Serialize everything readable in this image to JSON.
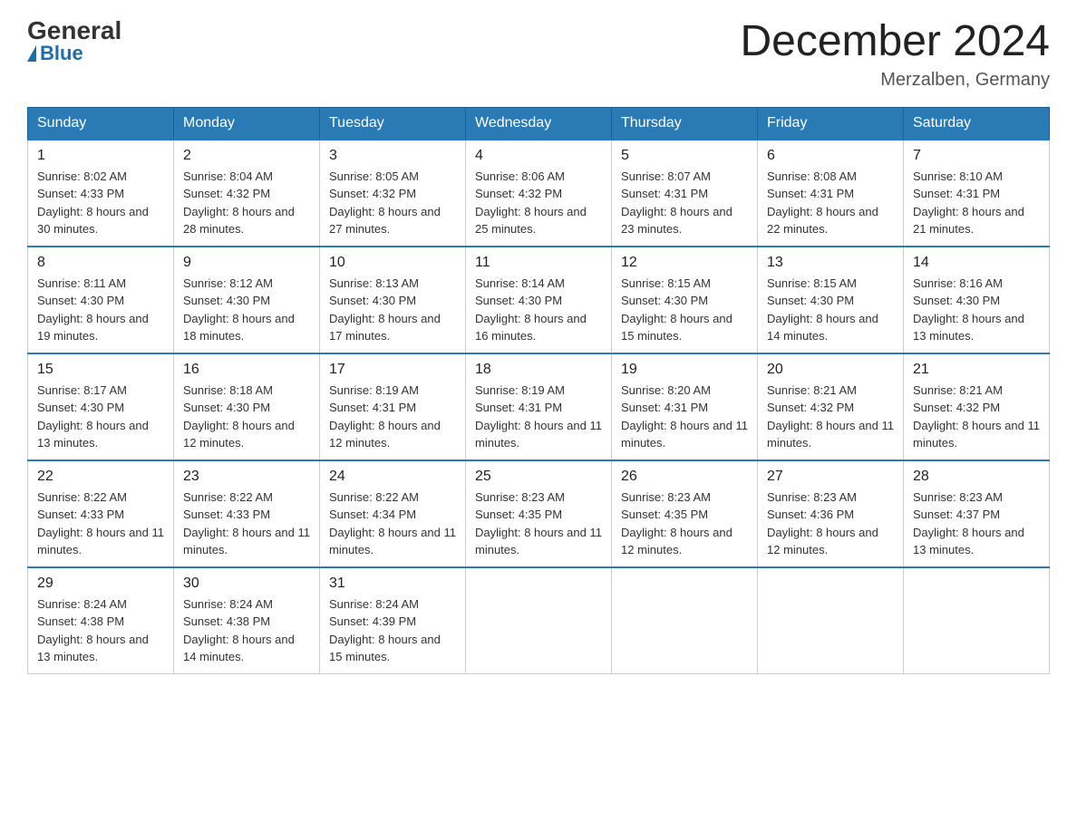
{
  "logo": {
    "general": "General",
    "blue": "Blue"
  },
  "title": "December 2024",
  "location": "Merzalben, Germany",
  "days_of_week": [
    "Sunday",
    "Monday",
    "Tuesday",
    "Wednesday",
    "Thursday",
    "Friday",
    "Saturday"
  ],
  "weeks": [
    [
      {
        "day": "1",
        "sunrise": "8:02 AM",
        "sunset": "4:33 PM",
        "daylight": "8 hours and 30 minutes."
      },
      {
        "day": "2",
        "sunrise": "8:04 AM",
        "sunset": "4:32 PM",
        "daylight": "8 hours and 28 minutes."
      },
      {
        "day": "3",
        "sunrise": "8:05 AM",
        "sunset": "4:32 PM",
        "daylight": "8 hours and 27 minutes."
      },
      {
        "day": "4",
        "sunrise": "8:06 AM",
        "sunset": "4:32 PM",
        "daylight": "8 hours and 25 minutes."
      },
      {
        "day": "5",
        "sunrise": "8:07 AM",
        "sunset": "4:31 PM",
        "daylight": "8 hours and 23 minutes."
      },
      {
        "day": "6",
        "sunrise": "8:08 AM",
        "sunset": "4:31 PM",
        "daylight": "8 hours and 22 minutes."
      },
      {
        "day": "7",
        "sunrise": "8:10 AM",
        "sunset": "4:31 PM",
        "daylight": "8 hours and 21 minutes."
      }
    ],
    [
      {
        "day": "8",
        "sunrise": "8:11 AM",
        "sunset": "4:30 PM",
        "daylight": "8 hours and 19 minutes."
      },
      {
        "day": "9",
        "sunrise": "8:12 AM",
        "sunset": "4:30 PM",
        "daylight": "8 hours and 18 minutes."
      },
      {
        "day": "10",
        "sunrise": "8:13 AM",
        "sunset": "4:30 PM",
        "daylight": "8 hours and 17 minutes."
      },
      {
        "day": "11",
        "sunrise": "8:14 AM",
        "sunset": "4:30 PM",
        "daylight": "8 hours and 16 minutes."
      },
      {
        "day": "12",
        "sunrise": "8:15 AM",
        "sunset": "4:30 PM",
        "daylight": "8 hours and 15 minutes."
      },
      {
        "day": "13",
        "sunrise": "8:15 AM",
        "sunset": "4:30 PM",
        "daylight": "8 hours and 14 minutes."
      },
      {
        "day": "14",
        "sunrise": "8:16 AM",
        "sunset": "4:30 PM",
        "daylight": "8 hours and 13 minutes."
      }
    ],
    [
      {
        "day": "15",
        "sunrise": "8:17 AM",
        "sunset": "4:30 PM",
        "daylight": "8 hours and 13 minutes."
      },
      {
        "day": "16",
        "sunrise": "8:18 AM",
        "sunset": "4:30 PM",
        "daylight": "8 hours and 12 minutes."
      },
      {
        "day": "17",
        "sunrise": "8:19 AM",
        "sunset": "4:31 PM",
        "daylight": "8 hours and 12 minutes."
      },
      {
        "day": "18",
        "sunrise": "8:19 AM",
        "sunset": "4:31 PM",
        "daylight": "8 hours and 11 minutes."
      },
      {
        "day": "19",
        "sunrise": "8:20 AM",
        "sunset": "4:31 PM",
        "daylight": "8 hours and 11 minutes."
      },
      {
        "day": "20",
        "sunrise": "8:21 AM",
        "sunset": "4:32 PM",
        "daylight": "8 hours and 11 minutes."
      },
      {
        "day": "21",
        "sunrise": "8:21 AM",
        "sunset": "4:32 PM",
        "daylight": "8 hours and 11 minutes."
      }
    ],
    [
      {
        "day": "22",
        "sunrise": "8:22 AM",
        "sunset": "4:33 PM",
        "daylight": "8 hours and 11 minutes."
      },
      {
        "day": "23",
        "sunrise": "8:22 AM",
        "sunset": "4:33 PM",
        "daylight": "8 hours and 11 minutes."
      },
      {
        "day": "24",
        "sunrise": "8:22 AM",
        "sunset": "4:34 PM",
        "daylight": "8 hours and 11 minutes."
      },
      {
        "day": "25",
        "sunrise": "8:23 AM",
        "sunset": "4:35 PM",
        "daylight": "8 hours and 11 minutes."
      },
      {
        "day": "26",
        "sunrise": "8:23 AM",
        "sunset": "4:35 PM",
        "daylight": "8 hours and 12 minutes."
      },
      {
        "day": "27",
        "sunrise": "8:23 AM",
        "sunset": "4:36 PM",
        "daylight": "8 hours and 12 minutes."
      },
      {
        "day": "28",
        "sunrise": "8:23 AM",
        "sunset": "4:37 PM",
        "daylight": "8 hours and 13 minutes."
      }
    ],
    [
      {
        "day": "29",
        "sunrise": "8:24 AM",
        "sunset": "4:38 PM",
        "daylight": "8 hours and 13 minutes."
      },
      {
        "day": "30",
        "sunrise": "8:24 AM",
        "sunset": "4:38 PM",
        "daylight": "8 hours and 14 minutes."
      },
      {
        "day": "31",
        "sunrise": "8:24 AM",
        "sunset": "4:39 PM",
        "daylight": "8 hours and 15 minutes."
      },
      null,
      null,
      null,
      null
    ]
  ],
  "labels": {
    "sunrise": "Sunrise:",
    "sunset": "Sunset:",
    "daylight": "Daylight:"
  }
}
